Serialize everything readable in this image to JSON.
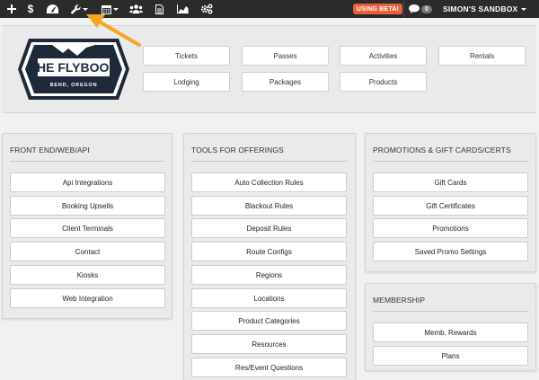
{
  "topbar": {
    "icons": [
      "plus-icon",
      "dollar-icon",
      "dashboard-icon",
      "wrench-icon",
      "calendar-icon",
      "users-icon",
      "document-icon",
      "chart-icon",
      "gears-icon"
    ],
    "beta_label": "USING BETA!",
    "message_count": "0",
    "account_label": "SIMON'S SANDBOX"
  },
  "logo": {
    "title": "THE FLYBOOK",
    "subtitle": "BEND, OREGON"
  },
  "quick_links": [
    "Tickets",
    "Passes",
    "Activities",
    "Rentals",
    "Lodging",
    "Packages",
    "Products"
  ],
  "sections": {
    "front_end": {
      "title": "FRONT END/WEB/API",
      "items": [
        "Api Integrations",
        "Booking Upsells",
        "Client Terminals",
        "Contact",
        "Kiosks",
        "Web Integration"
      ]
    },
    "tools": {
      "title": "TOOLS FOR OFFERINGS",
      "items": [
        "Auto Collection Rules",
        "Blackout Rules",
        "Deposit Rules",
        "Route Configs",
        "Regions",
        "Locations",
        "Product Categories",
        "Resources",
        "Res/Event Questions"
      ]
    },
    "promotions": {
      "title": "PROMOTIONS & GIFT CARDS/CERTS",
      "items": [
        "Gift Cards",
        "Gift Certificates",
        "Promotions",
        "Saved Promo Settings"
      ]
    },
    "membership": {
      "title": "MEMBERSHIP",
      "items": [
        "Memb. Rewards",
        "Plans"
      ]
    }
  },
  "colors": {
    "topbar": "#2b2b2b",
    "beta": "#e8603c",
    "arrow": "#f5a623"
  }
}
